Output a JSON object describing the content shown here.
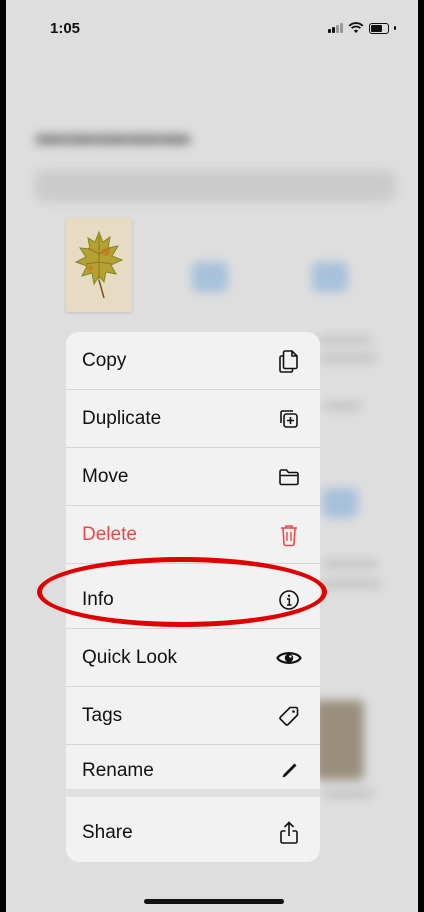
{
  "status_bar": {
    "time": "1:05"
  },
  "context_menu": {
    "items": [
      {
        "label": "Copy",
        "icon": "copy-icon"
      },
      {
        "label": "Duplicate",
        "icon": "duplicate-icon"
      },
      {
        "label": "Move",
        "icon": "folder-icon"
      },
      {
        "label": "Delete",
        "icon": "trash-icon",
        "destructive": true
      },
      {
        "label": "Info",
        "icon": "info-icon",
        "highlighted": true
      },
      {
        "label": "Quick Look",
        "icon": "eye-icon"
      },
      {
        "label": "Tags",
        "icon": "tag-icon"
      },
      {
        "label": "Rename",
        "icon": "pencil-icon"
      },
      {
        "label": "Share",
        "icon": "share-icon"
      }
    ]
  },
  "colors": {
    "destructive": "#e84a4a",
    "highlight_ring": "#e00000",
    "menu_background": "#f2f2f2",
    "leaf": "#b5a032"
  }
}
